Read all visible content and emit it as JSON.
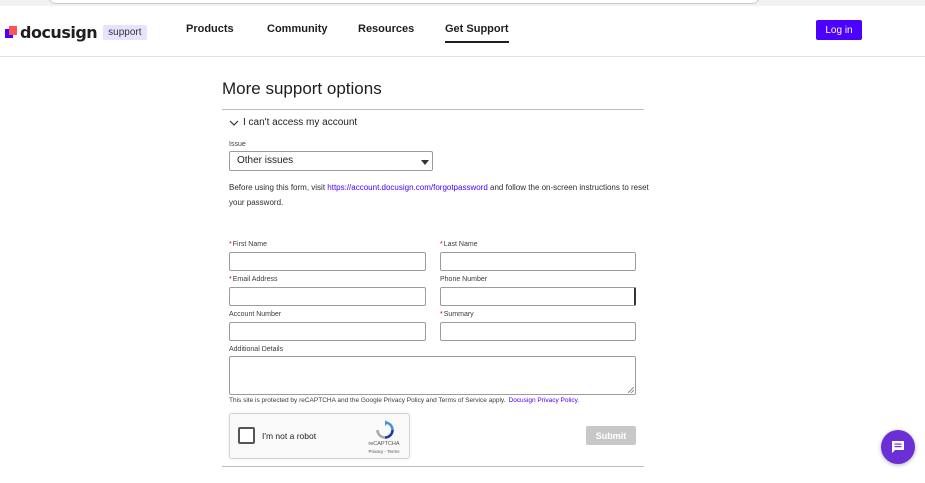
{
  "header": {
    "logo_word": "docusign",
    "logo_tag": "support",
    "nav": [
      "Products",
      "Community",
      "Resources",
      "Get Support"
    ],
    "active_nav": "Get Support",
    "login_label": "Log in"
  },
  "section": {
    "title": "More support options",
    "accordion_label": "I can't access my account"
  },
  "form": {
    "issue_label": "Issue",
    "issue_value": "Other issues",
    "info_before": "Before using this form, visit ",
    "info_link": "https://account.docusign.com/forgotpassword",
    "info_after": " and follow the on-screen instructions to reset your password.",
    "first_name_label": "First Name",
    "last_name_label": "Last Name",
    "email_label": "Email Address",
    "phone_label": "Phone Number",
    "account_label": "Account Number",
    "summary_label": "Summary",
    "details_label": "Additional Details",
    "required_mark": "*",
    "recaptcha_note": "This site is protected by reCAPTCHA and the Google Privacy Policy and Terms of Service apply.",
    "privacy_link": "Docusign Privacy Policy.",
    "submit_label": "Submit"
  },
  "recaptcha": {
    "label": "I'm not a robot",
    "brand": "reCAPTCHA",
    "links": "Privacy - Terms"
  },
  "colors": {
    "brand": "#4c00ff",
    "chat": "#6b2fd6",
    "required": "#d00000"
  },
  "icons": {
    "chevron": "chevron-down-icon",
    "chat": "chat-bubble-icon",
    "recaptcha": "recaptcha-logo-icon"
  }
}
